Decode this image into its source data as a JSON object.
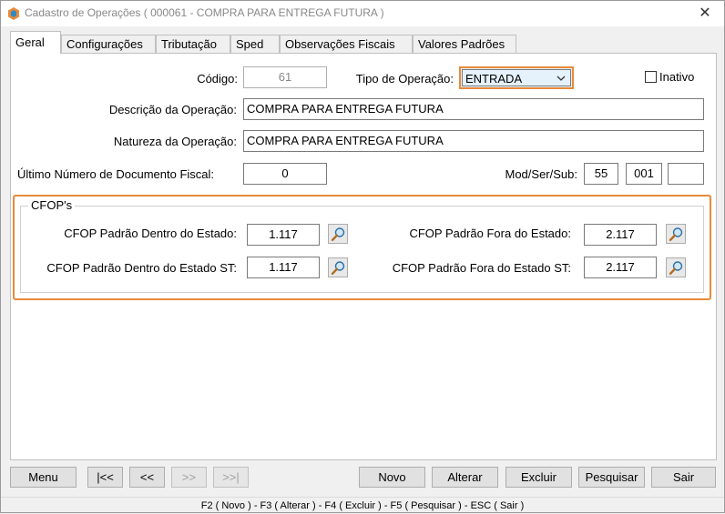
{
  "window": {
    "title": "Cadastro de Operações ( 000061 - COMPRA PARA ENTREGA FUTURA )",
    "close_glyph": "✕"
  },
  "tabs": [
    {
      "label": "Geral",
      "active": true
    },
    {
      "label": "Configurações",
      "active": false
    },
    {
      "label": "Tributação",
      "active": false
    },
    {
      "label": "Sped",
      "active": false
    },
    {
      "label": "Observações Fiscais",
      "active": false
    },
    {
      "label": "Valores Padrões",
      "active": false
    }
  ],
  "form": {
    "codigo_label": "Código:",
    "codigo_value": "61",
    "tipo_label": "Tipo de Operação:",
    "tipo_value": "ENTRADA",
    "inativo_label": "Inativo",
    "descricao_label": "Descrição da Operação:",
    "descricao_value": "COMPRA PARA ENTREGA FUTURA",
    "natureza_label": "Natureza da Operação:",
    "natureza_value": "COMPRA PARA ENTREGA FUTURA",
    "ultimo_label": "Último Número de Documento Fiscal:",
    "ultimo_value": "0",
    "modsersub_label": "Mod/Ser/Sub:",
    "mod_value": "55",
    "ser_value": "001",
    "sub_value": ""
  },
  "cfops": {
    "group_title": "CFOP's",
    "dentro_label": "CFOP Padrão Dentro do Estado:",
    "dentro_value": "1.117",
    "fora_label": "CFOP Padrão Fora do Estado:",
    "fora_value": "2.117",
    "dentro_st_label": "CFOP Padrão Dentro do Estado ST:",
    "dentro_st_value": "1.117",
    "fora_st_label": "CFOP Padrão Fora do Estado ST:",
    "fora_st_value": "2.117"
  },
  "buttons": {
    "menu": "Menu",
    "first": "|<<",
    "prev": "<<",
    "next": ">>",
    "last": ">>|",
    "novo": "Novo",
    "alterar": "Alterar",
    "excluir": "Excluir",
    "pesquisar": "Pesquisar",
    "sair": "Sair"
  },
  "footer": {
    "shortcuts": "F2 ( Novo )  -  F3 ( Alterar )  -  F4 ( Excluir )  -  F5 ( Pesquisar )  -  ESC ( Sair )"
  },
  "colors": {
    "highlight": "#e88a3a",
    "select_bg": "#e5f1fb"
  },
  "icons": {
    "app": "app-logo-icon",
    "search": "magnifier-icon",
    "dropdown": "chevron-down-icon"
  }
}
